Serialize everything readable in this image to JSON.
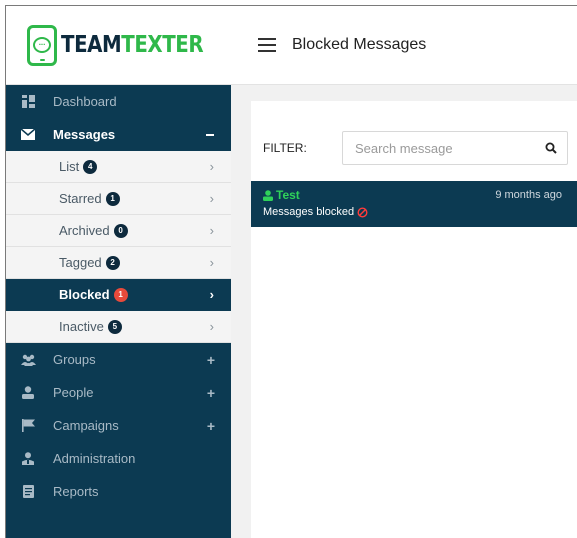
{
  "brand": {
    "team": "TEAM",
    "texter": "TEXTER",
    "brand_color": "#2fb84a",
    "navy": "#0c3a52"
  },
  "header": {
    "title": "Blocked Messages"
  },
  "sidebar": {
    "items": [
      {
        "label": "Dashboard",
        "icon": "dashboard-icon"
      },
      {
        "label": "Messages",
        "icon": "envelope-icon"
      },
      {
        "label": "Groups",
        "icon": "groups-icon",
        "expand": "+"
      },
      {
        "label": "People",
        "icon": "person-icon",
        "expand": "+"
      },
      {
        "label": "Campaigns",
        "icon": "flag-icon",
        "expand": "+"
      },
      {
        "label": "Administration",
        "icon": "admin-icon"
      },
      {
        "label": "Reports",
        "icon": "report-icon"
      }
    ],
    "messages_sub": [
      {
        "label": "List",
        "count": "4"
      },
      {
        "label": "Starred",
        "count": "1"
      },
      {
        "label": "Archived",
        "count": "0"
      },
      {
        "label": "Tagged",
        "count": "2"
      },
      {
        "label": "Blocked",
        "count": "1"
      },
      {
        "label": "Inactive",
        "count": "5"
      }
    ]
  },
  "filter": {
    "label": "FILTER:",
    "placeholder": "Search message"
  },
  "messages": [
    {
      "name": "Test",
      "time": "9 months ago",
      "text": "Messages blocked"
    }
  ]
}
